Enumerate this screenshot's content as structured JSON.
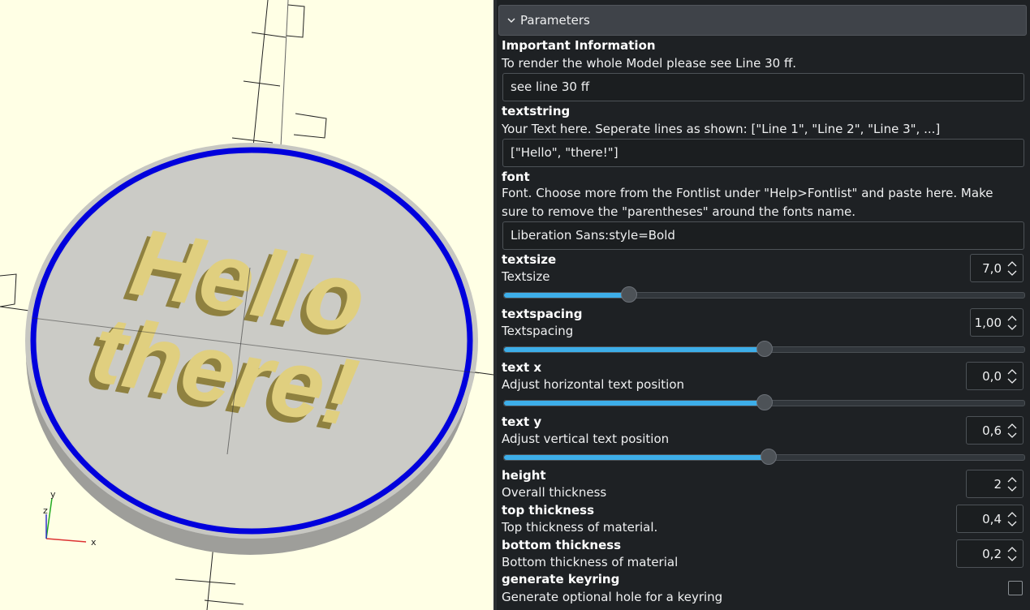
{
  "viewport": {
    "model_text_line1": "Hello",
    "model_text_line2": "there!",
    "axis_x_label": "x",
    "axis_y_label": "y",
    "axis_z_label": "z"
  },
  "panel": {
    "header_title": "Parameters",
    "params": {
      "important": {
        "label": "Important Information",
        "description": "To render the whole Model please see Line 30 ff.",
        "value": "see line 30 ff"
      },
      "textstring": {
        "label": "textstring",
        "description": "Your Text here. Seperate lines as shown: [\"Line 1\", \"Line 2\", \"Line 3\", ...]",
        "value": "[\"Hello\", \"there!\"]"
      },
      "font": {
        "label": "font",
        "description": "Font. Choose more from the Fontlist under \"Help>Fontlist\" and paste here. Make sure to remove the  \"parentheses\" around the fonts name.",
        "value": "Liberation Sans:style=Bold"
      },
      "textsize": {
        "label": "textsize",
        "description": "Textsize",
        "value": "7,0",
        "slider_fraction": 0.24
      },
      "textspacing": {
        "label": "textspacing",
        "description": "Textspacing",
        "value": "1,00",
        "slider_fraction": 0.5
      },
      "text_x": {
        "label": "text x",
        "description": "Adjust horizontal text position",
        "value": "0,0",
        "slider_fraction": 0.5
      },
      "text_y": {
        "label": "text y",
        "description": "Adjust vertical text position",
        "value": "0,6",
        "slider_fraction": 0.508
      },
      "height": {
        "label": "height",
        "description": "Overall thickness",
        "value": "2"
      },
      "top_thickness": {
        "label": "top thickness",
        "description": "Top thickness of material.",
        "value": "0,4"
      },
      "bottom_thickness": {
        "label": "bottom thickness",
        "description": "Bottom thickness of material",
        "value": "0,2"
      },
      "keyring": {
        "label": "generate keyring",
        "description": "Generate optional hole for a keyring",
        "checked": false
      }
    }
  },
  "colors": {
    "viewport_bg": "#ffffe5",
    "panel_bg": "#1e2124",
    "accent": "#3daee9",
    "ring": "#0000dd",
    "text_model": "#e0cf7f"
  }
}
